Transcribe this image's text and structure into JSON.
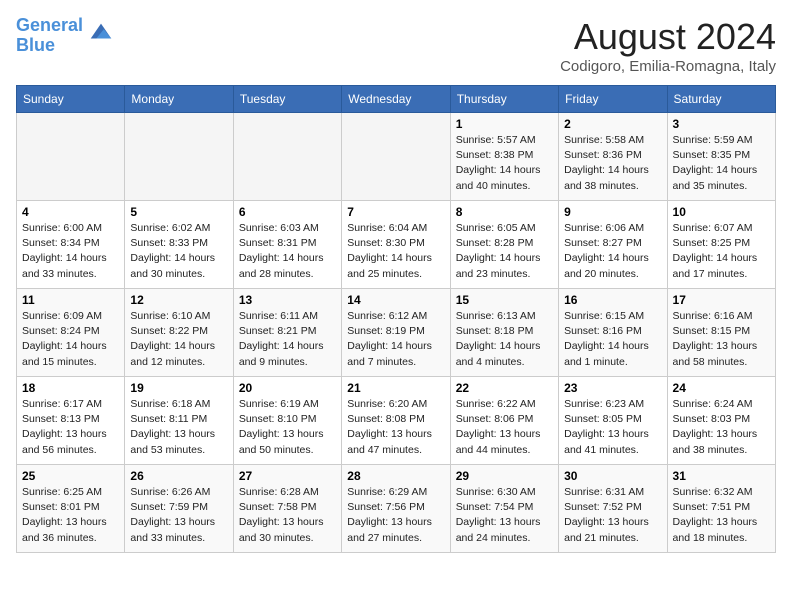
{
  "header": {
    "logo_line1": "General",
    "logo_line2": "Blue",
    "month_title": "August 2024",
    "location": "Codigoro, Emilia-Romagna, Italy"
  },
  "weekdays": [
    "Sunday",
    "Monday",
    "Tuesday",
    "Wednesday",
    "Thursday",
    "Friday",
    "Saturday"
  ],
  "weeks": [
    [
      {
        "day": "",
        "info": ""
      },
      {
        "day": "",
        "info": ""
      },
      {
        "day": "",
        "info": ""
      },
      {
        "day": "",
        "info": ""
      },
      {
        "day": "1",
        "info": "Sunrise: 5:57 AM\nSunset: 8:38 PM\nDaylight: 14 hours\nand 40 minutes."
      },
      {
        "day": "2",
        "info": "Sunrise: 5:58 AM\nSunset: 8:36 PM\nDaylight: 14 hours\nand 38 minutes."
      },
      {
        "day": "3",
        "info": "Sunrise: 5:59 AM\nSunset: 8:35 PM\nDaylight: 14 hours\nand 35 minutes."
      }
    ],
    [
      {
        "day": "4",
        "info": "Sunrise: 6:00 AM\nSunset: 8:34 PM\nDaylight: 14 hours\nand 33 minutes."
      },
      {
        "day": "5",
        "info": "Sunrise: 6:02 AM\nSunset: 8:33 PM\nDaylight: 14 hours\nand 30 minutes."
      },
      {
        "day": "6",
        "info": "Sunrise: 6:03 AM\nSunset: 8:31 PM\nDaylight: 14 hours\nand 28 minutes."
      },
      {
        "day": "7",
        "info": "Sunrise: 6:04 AM\nSunset: 8:30 PM\nDaylight: 14 hours\nand 25 minutes."
      },
      {
        "day": "8",
        "info": "Sunrise: 6:05 AM\nSunset: 8:28 PM\nDaylight: 14 hours\nand 23 minutes."
      },
      {
        "day": "9",
        "info": "Sunrise: 6:06 AM\nSunset: 8:27 PM\nDaylight: 14 hours\nand 20 minutes."
      },
      {
        "day": "10",
        "info": "Sunrise: 6:07 AM\nSunset: 8:25 PM\nDaylight: 14 hours\nand 17 minutes."
      }
    ],
    [
      {
        "day": "11",
        "info": "Sunrise: 6:09 AM\nSunset: 8:24 PM\nDaylight: 14 hours\nand 15 minutes."
      },
      {
        "day": "12",
        "info": "Sunrise: 6:10 AM\nSunset: 8:22 PM\nDaylight: 14 hours\nand 12 minutes."
      },
      {
        "day": "13",
        "info": "Sunrise: 6:11 AM\nSunset: 8:21 PM\nDaylight: 14 hours\nand 9 minutes."
      },
      {
        "day": "14",
        "info": "Sunrise: 6:12 AM\nSunset: 8:19 PM\nDaylight: 14 hours\nand 7 minutes."
      },
      {
        "day": "15",
        "info": "Sunrise: 6:13 AM\nSunset: 8:18 PM\nDaylight: 14 hours\nand 4 minutes."
      },
      {
        "day": "16",
        "info": "Sunrise: 6:15 AM\nSunset: 8:16 PM\nDaylight: 14 hours\nand 1 minute."
      },
      {
        "day": "17",
        "info": "Sunrise: 6:16 AM\nSunset: 8:15 PM\nDaylight: 13 hours\nand 58 minutes."
      }
    ],
    [
      {
        "day": "18",
        "info": "Sunrise: 6:17 AM\nSunset: 8:13 PM\nDaylight: 13 hours\nand 56 minutes."
      },
      {
        "day": "19",
        "info": "Sunrise: 6:18 AM\nSunset: 8:11 PM\nDaylight: 13 hours\nand 53 minutes."
      },
      {
        "day": "20",
        "info": "Sunrise: 6:19 AM\nSunset: 8:10 PM\nDaylight: 13 hours\nand 50 minutes."
      },
      {
        "day": "21",
        "info": "Sunrise: 6:20 AM\nSunset: 8:08 PM\nDaylight: 13 hours\nand 47 minutes."
      },
      {
        "day": "22",
        "info": "Sunrise: 6:22 AM\nSunset: 8:06 PM\nDaylight: 13 hours\nand 44 minutes."
      },
      {
        "day": "23",
        "info": "Sunrise: 6:23 AM\nSunset: 8:05 PM\nDaylight: 13 hours\nand 41 minutes."
      },
      {
        "day": "24",
        "info": "Sunrise: 6:24 AM\nSunset: 8:03 PM\nDaylight: 13 hours\nand 38 minutes."
      }
    ],
    [
      {
        "day": "25",
        "info": "Sunrise: 6:25 AM\nSunset: 8:01 PM\nDaylight: 13 hours\nand 36 minutes."
      },
      {
        "day": "26",
        "info": "Sunrise: 6:26 AM\nSunset: 7:59 PM\nDaylight: 13 hours\nand 33 minutes."
      },
      {
        "day": "27",
        "info": "Sunrise: 6:28 AM\nSunset: 7:58 PM\nDaylight: 13 hours\nand 30 minutes."
      },
      {
        "day": "28",
        "info": "Sunrise: 6:29 AM\nSunset: 7:56 PM\nDaylight: 13 hours\nand 27 minutes."
      },
      {
        "day": "29",
        "info": "Sunrise: 6:30 AM\nSunset: 7:54 PM\nDaylight: 13 hours\nand 24 minutes."
      },
      {
        "day": "30",
        "info": "Sunrise: 6:31 AM\nSunset: 7:52 PM\nDaylight: 13 hours\nand 21 minutes."
      },
      {
        "day": "31",
        "info": "Sunrise: 6:32 AM\nSunset: 7:51 PM\nDaylight: 13 hours\nand 18 minutes."
      }
    ]
  ]
}
